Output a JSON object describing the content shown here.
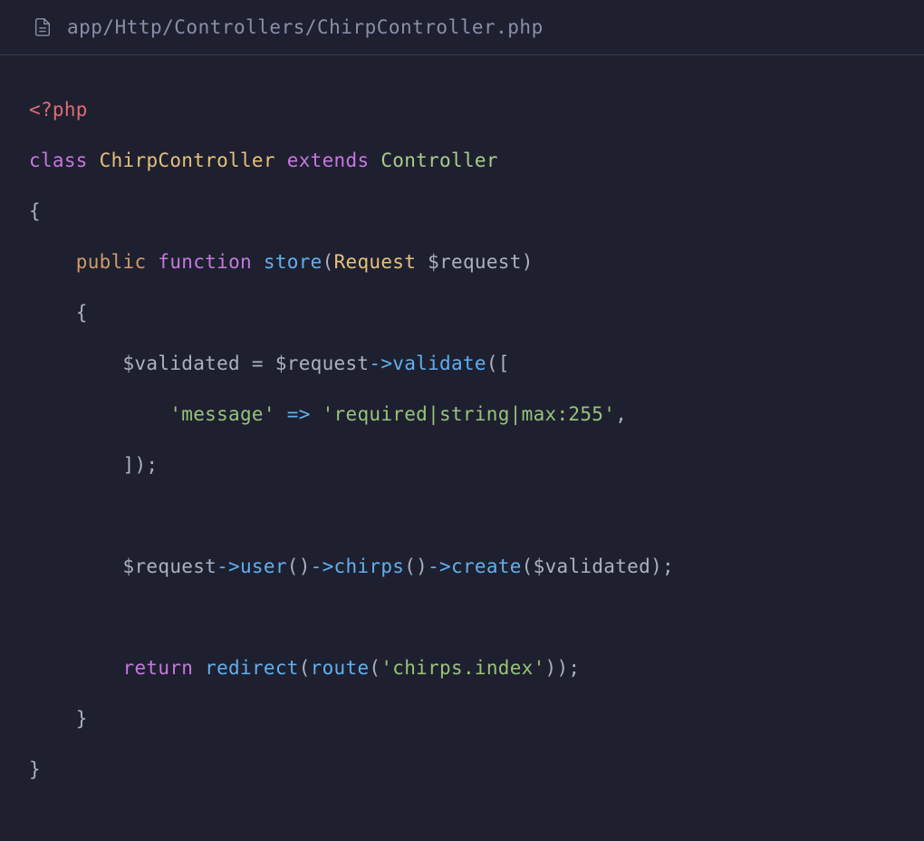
{
  "header": {
    "filepath": "app/Http/Controllers/ChirpController.php"
  },
  "code": {
    "line1": {
      "open_tag": "<?php"
    },
    "line2": {
      "class_kw": "class",
      "classname": "ChirpController",
      "extends_kw": "extends",
      "parent": "Controller"
    },
    "line3": {
      "brace": "{"
    },
    "line4": {
      "visibility": "public",
      "function_kw": "function",
      "funcname": "store",
      "paren_open": "(",
      "type": "Request",
      "param": "$request",
      "paren_close": ")"
    },
    "line5": {
      "brace": "{"
    },
    "line6": {
      "var": "$validated",
      "eq": " = ",
      "req": "$request",
      "arrow": "->",
      "method": "validate",
      "tail": "(["
    },
    "line7": {
      "key": "'message'",
      "fatarrow": " => ",
      "val": "'required|string|max:255'",
      "comma": ","
    },
    "line8": {
      "close": "]);"
    },
    "line9": {
      "req": "$request",
      "arrow1": "->",
      "user": "user",
      "parens1": "()",
      "arrow2": "->",
      "chirps": "chirps",
      "parens2": "()",
      "arrow3": "->",
      "create": "create",
      "open": "(",
      "arg": "$validated",
      "close": ");"
    },
    "line10": {
      "return_kw": "return",
      "redirect": "redirect",
      "open1": "(",
      "route": "route",
      "open2": "(",
      "routename": "'chirps.index'",
      "close": "));"
    },
    "line11": {
      "brace": "}"
    },
    "line12": {
      "brace": "}"
    }
  }
}
